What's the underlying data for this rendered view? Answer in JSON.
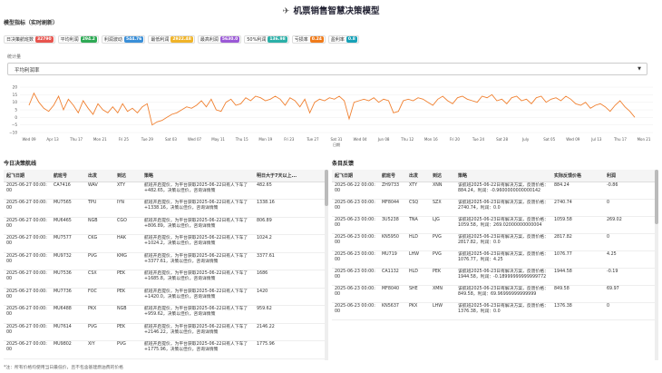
{
  "header": {
    "title": "机票销售智慧决策模型",
    "icon": "plane-icon"
  },
  "kpi_section": {
    "label": "模型指标（实时刷新）"
  },
  "kpis": [
    {
      "label": "日决策航班数",
      "value": "32790",
      "color": "#e8544e"
    },
    {
      "label": "平均利润",
      "value": "294.2",
      "color": "#2eaa55"
    },
    {
      "label": "利润波动",
      "value": "544.76",
      "color": "#3a8fd8"
    },
    {
      "label": "最低利润",
      "value": "2922.48",
      "color": "#f0b429"
    },
    {
      "label": "最高利润",
      "value": "5630.0",
      "color": "#9b59d6"
    },
    {
      "label": "50%利润",
      "value": "136.98",
      "color": "#2bb0a8"
    },
    {
      "label": "亏损率",
      "value": "0.24",
      "color": "#f07b1a"
    },
    {
      "label": "盈利率",
      "value": "0.8",
      "color": "#17a2b8"
    }
  ],
  "stat": {
    "label": "统计量",
    "selected": "平均利润率"
  },
  "chart_data": {
    "type": "line",
    "y_ticks": [
      "20",
      "15",
      "10",
      "5",
      "0",
      "−5",
      "−10"
    ],
    "ylim": [
      -10,
      20
    ],
    "x_ticks": [
      "Wed 09",
      "Apr 13",
      "Thu 17",
      "Mon 21",
      "Fri 25",
      "Tue 29",
      "Sat 03",
      "Wed 07",
      "May 11",
      "Thu 15",
      "Mon 19",
      "Fri 23",
      "Tue 27",
      "Sat 31",
      "Wed 04",
      "Jun 08",
      "Thu 12",
      "Mon 16",
      "Fri 20",
      "Tue 24",
      "Sat 28",
      "July",
      "Sat 05",
      "Wed 09",
      "Jul 13",
      "Thu 17",
      "Mon 21"
    ],
    "xlabel": "日期",
    "color": "#f08030",
    "values": [
      8,
      16,
      10,
      6,
      4,
      8,
      14,
      5,
      12,
      8,
      3,
      11,
      6,
      2,
      9,
      5,
      3,
      7,
      3,
      9,
      4,
      6,
      3,
      7,
      9,
      -5,
      -3,
      -2,
      0,
      2,
      3,
      5,
      7,
      6,
      8,
      11,
      7,
      12,
      5,
      4,
      10,
      12,
      8,
      9,
      13,
      11,
      14,
      13,
      11,
      12,
      14,
      12,
      8,
      13,
      11,
      7,
      12,
      3,
      10,
      12,
      11,
      13,
      12,
      14,
      11,
      -1,
      10,
      11,
      12,
      11,
      13,
      10,
      12,
      11,
      3,
      4,
      11,
      12,
      11,
      13,
      12,
      10,
      8,
      12,
      14,
      11,
      9,
      13,
      14,
      12,
      11,
      10,
      14,
      13,
      15,
      11,
      12,
      9,
      13,
      14,
      11,
      12,
      9,
      13,
      14,
      10,
      12,
      13,
      11,
      14,
      12,
      9,
      8,
      10,
      6,
      8,
      9,
      7,
      4,
      8,
      11,
      7,
      4,
      0
    ]
  },
  "today": {
    "title": "今日决策航线",
    "columns": [
      "起飞日期",
      "航班号",
      "出发",
      "到达",
      "策略",
      "明日大于7天以上..."
    ],
    "rows": [
      [
        "2025-06-27 00:00:00",
        "CA7416",
        "WAV",
        "XTY",
        "航班开启提价，为平台获取2025-06-22日有人下车了+482.65，决策以佳价，咨询详情策",
        "482.65"
      ],
      [
        "2025-06-27 00:00:00",
        "MU7565",
        "TPU",
        "IYN",
        "航班开启提价，为平台获取2025-06-22日有人下车了+1338.16，决策以佳价，咨询详情策",
        "1338.16"
      ],
      [
        "2025-06-27 00:00:00",
        "MU6465",
        "NGB",
        "CGO",
        "航班开启提价，为平台获取2025-06-22日有人下车了+806.89，决策以佳价，咨询详情策",
        "806.89"
      ],
      [
        "2025-06-27 00:00:00",
        "MU7577",
        "CKG",
        "HAK",
        "航班开启提价，为平台获取2025-06-22日有人下车了+1024.2，决策以佳价，咨询详情策",
        "1024.2"
      ],
      [
        "2025-06-27 00:00:00",
        "MU9732",
        "PVG",
        "KMG",
        "航班开启提价，为平台获取2025-06-22日有人下车了+3377.61，决策以佳价，咨询详情策",
        "3377.61"
      ],
      [
        "2025-06-27 00:00:00",
        "MU7536",
        "CSX",
        "PEK",
        "航班开启提价，为平台获取2025-06-22日有人下车了+1685.8，决策以佳价，咨询详情策",
        "1686"
      ],
      [
        "2025-06-27 00:00:00",
        "MU7736",
        "FOC",
        "PEK",
        "航班开启提价，为平台获取2025-06-22日有人下车了+1420.0，决策以佳价，咨询详情策",
        "1420"
      ],
      [
        "2025-06-27 00:00:00",
        "MU6488",
        "PKX",
        "NGB",
        "航班开启提价，为平台获取2025-06-22日有人下车了+959.62，决策以佳价，咨询详情策",
        "959.62"
      ],
      [
        "2025-06-27 00:00:00",
        "MU7614",
        "PVG",
        "PEK",
        "航班开启提价，为平台获取2025-06-22日有人下车了+2146.22，决策以佳价，咨询详情策",
        "2146.22"
      ],
      [
        "2025-06-27 00:00:00",
        "MU9802",
        "XIY",
        "PVG",
        "航班开启提价，为平台获取2025-06-22日有人下车了+1775.96，决策以佳价，咨询详情策",
        "1775.96"
      ]
    ]
  },
  "history": {
    "title": "条目反馈",
    "columns": [
      "起飞日期",
      "航班号",
      "出发",
      "到达",
      "策略",
      "实际反馈价格",
      "利润"
    ],
    "rows": [
      [
        "2025-06-22 00:00:00",
        "ZH9733",
        "XTY",
        "XNN",
        "该航班2025-06-22日有解决方案，反馈价格：884.24，利润：-0.9600000000000142",
        "884.24",
        "-0.86"
      ],
      [
        "2025-06-23 00:00:00",
        "MF8044",
        "CSQ",
        "SZX",
        "该航班2025-06-23日有解决方案，反馈价格：2740.74，利润：0.0",
        "2740.74",
        "0"
      ],
      [
        "2025-06-23 00:00:00",
        "3U5238",
        "TNA",
        "LJG",
        "该航班2025-06-23日有解决方案，反馈价格：1059.58，利润：269.02000000000004",
        "1059.58",
        "269.02"
      ],
      [
        "2025-06-23 00:00:00",
        "KN5950",
        "HLD",
        "PVG",
        "该航班2025-06-23日有解决方案，反馈价格：2817.82，利润：0.0",
        "2817.82",
        "0"
      ],
      [
        "2025-06-23 00:00:00",
        "MU719",
        "LHW",
        "PVG",
        "该航班2025-06-23日有解决方案，反馈价格：1076.77，利润：4.25",
        "1076.77",
        "4.25"
      ],
      [
        "2025-06-23 00:00:00",
        "CA1132",
        "HLD",
        "PEK",
        "该航班2025-06-23日有解决方案，反馈价格：1944.58，利润：-0.18999999999999772",
        "1944.58",
        "-0.19"
      ],
      [
        "2025-06-23 00:00:00",
        "MF8040",
        "SHE",
        "XMN",
        "该航班2025-06-23日有解决方案，反馈价格：849.58，利润：69.96999999999999",
        "849.58",
        "69.97"
      ],
      [
        "2025-06-23 00:00:00",
        "KN5637",
        "PKX",
        "LHW",
        "该航班2025-06-23日有解决方案，反馈价格：1376.38，利润：0.0",
        "1376.38",
        "0"
      ]
    ]
  },
  "footer": {
    "note": "*注：所有价格均使用当日最低价，且不包含基建燃油费的价格"
  }
}
